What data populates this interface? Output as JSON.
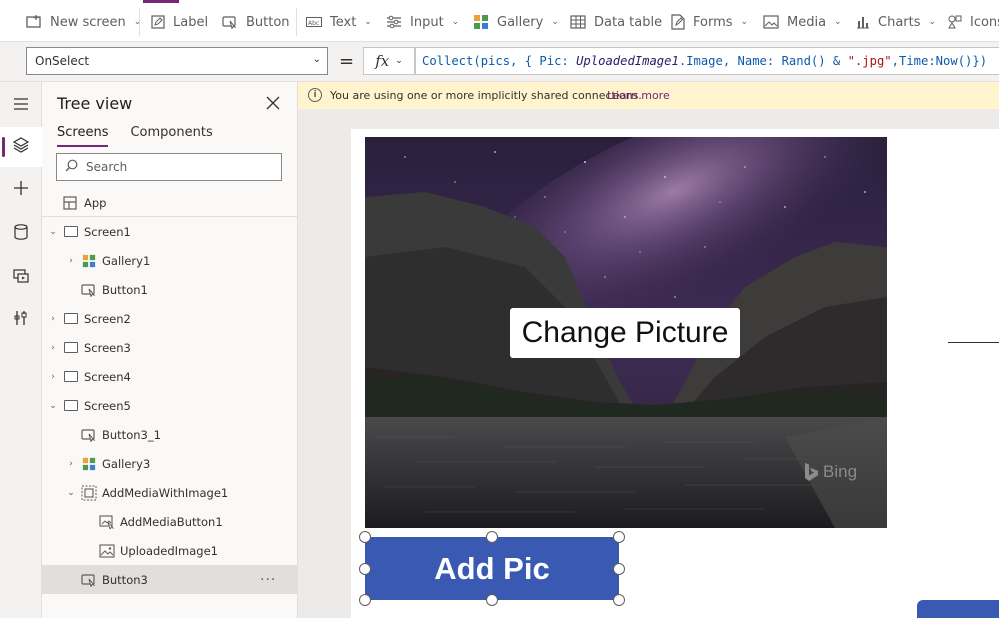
{
  "ribbon": {
    "new_screen": "New screen",
    "label": "Label",
    "button": "Button",
    "text": "Text",
    "input": "Input",
    "gallery": "Gallery",
    "data_table": "Data table",
    "forms": "Forms",
    "media": "Media",
    "charts": "Charts",
    "icons": "Icons"
  },
  "formula_bar": {
    "property": "OnSelect",
    "equals": "=",
    "fx": "fx",
    "formula": {
      "p1": "Collect(pics, { Pic: ",
      "p2": "UploadedImage1",
      "p3": ".Image, Name: ",
      "p4": "Rand",
      "p5": "() & ",
      "p6": "\".jpg\"",
      "p7": ",Time:",
      "p8": "Now",
      "p9": "()})"
    }
  },
  "tree_panel": {
    "title": "Tree view",
    "tabs": [
      "Screens",
      "Components"
    ],
    "search_placeholder": "Search",
    "app_label": "App",
    "items": [
      {
        "label": "Screen1"
      },
      {
        "label": "Gallery1"
      },
      {
        "label": "Button1"
      },
      {
        "label": "Screen2"
      },
      {
        "label": "Screen3"
      },
      {
        "label": "Screen4"
      },
      {
        "label": "Screen5"
      },
      {
        "label": "Button3_1"
      },
      {
        "label": "Gallery3"
      },
      {
        "label": "AddMediaWithImage1"
      },
      {
        "label": "AddMediaButton1"
      },
      {
        "label": "UploadedImage1"
      },
      {
        "label": "Button3",
        "selected": true
      }
    ],
    "more_icon": "more-icon"
  },
  "notice": {
    "message": "You are using one or more implicitly shared connections.",
    "link": "Learn more"
  },
  "canvas": {
    "change_picture": "Change Picture",
    "bing_watermark": "Bing",
    "add_pic": "Add Pic"
  },
  "colors": {
    "accent": "#742774",
    "button_fill": "#3a59b3",
    "notice_bg": "#fff4ce"
  }
}
